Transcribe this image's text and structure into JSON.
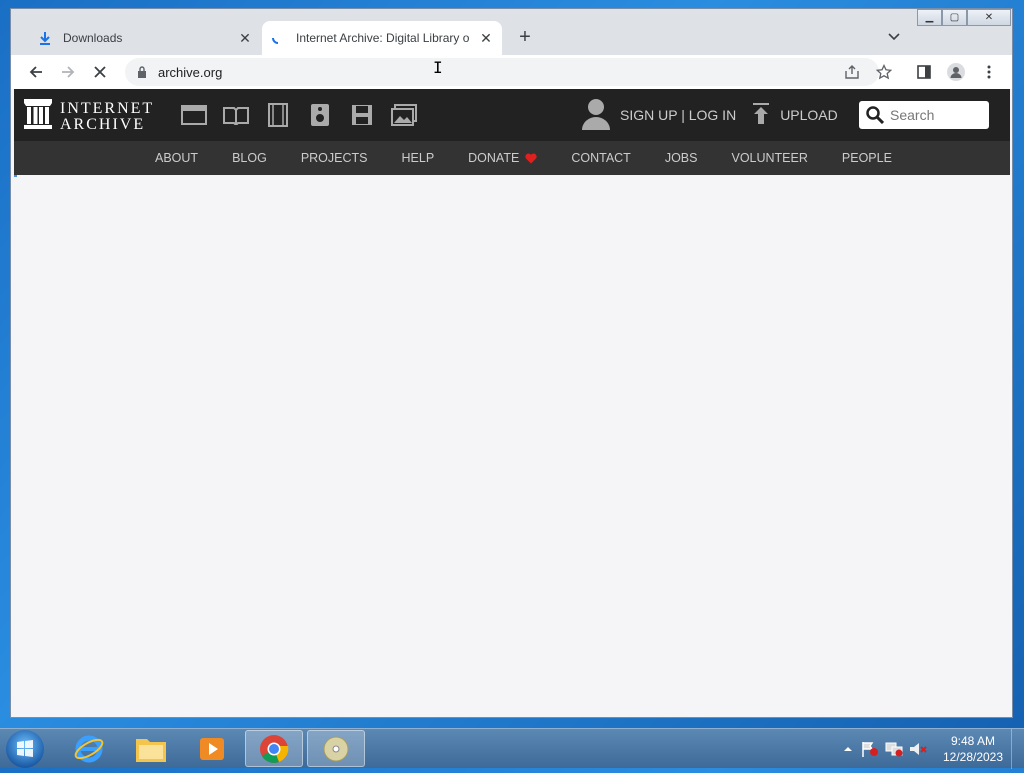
{
  "browser": {
    "tabs": [
      {
        "title": "Downloads",
        "icon": "download-icon",
        "active": false
      },
      {
        "title": "Internet Archive: Digital Library o",
        "icon": "loading-spinner-icon",
        "active": true
      }
    ],
    "url": "archive.org",
    "accent": "#1a73e8"
  },
  "site": {
    "logo_line1": "INTERNET",
    "logo_line2": "ARCHIVE",
    "auth_label": "SIGN UP | LOG IN",
    "upload_label": "UPLOAD",
    "search_placeholder": "Search",
    "nav": [
      "ABOUT",
      "BLOG",
      "PROJECTS",
      "HELP",
      "DONATE",
      "CONTACT",
      "JOBS",
      "VOLUNTEER",
      "PEOPLE"
    ],
    "heart_color": "#e0201f"
  },
  "taskbar": {
    "time": "9:48 AM",
    "date": "12/28/2023"
  }
}
